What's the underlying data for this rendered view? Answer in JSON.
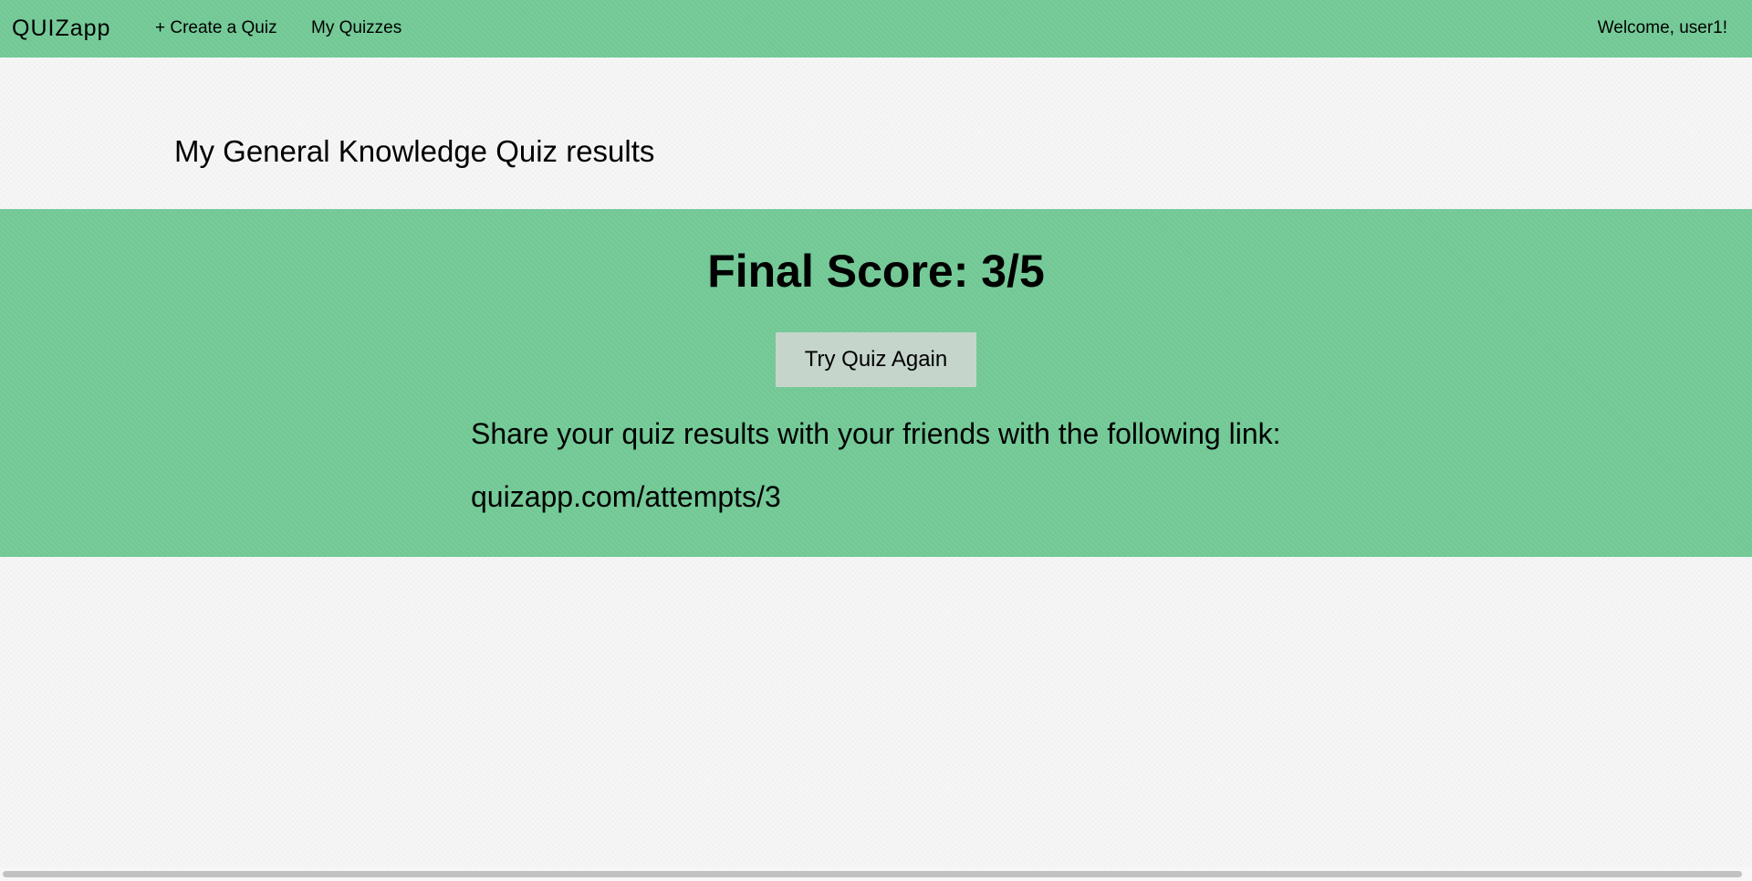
{
  "navbar": {
    "brand_strong": "QUIZ",
    "brand_light": "app",
    "links": [
      {
        "label": "+ Create a Quiz"
      },
      {
        "label": "My Quizzes"
      }
    ],
    "welcome": "Welcome, user1!"
  },
  "page": {
    "heading": "My General Knowledge Quiz results"
  },
  "results": {
    "final_score": "Final Score: 3/5",
    "retry_label": "Try Quiz Again",
    "share_text": "Share your quiz results with your friends with the following link:",
    "share_link": "quizapp.com/attempts/3"
  },
  "colors": {
    "accent_green": "#74cb98",
    "button_bg": "#c5d5cc",
    "page_bg": "#f7f7f7"
  }
}
